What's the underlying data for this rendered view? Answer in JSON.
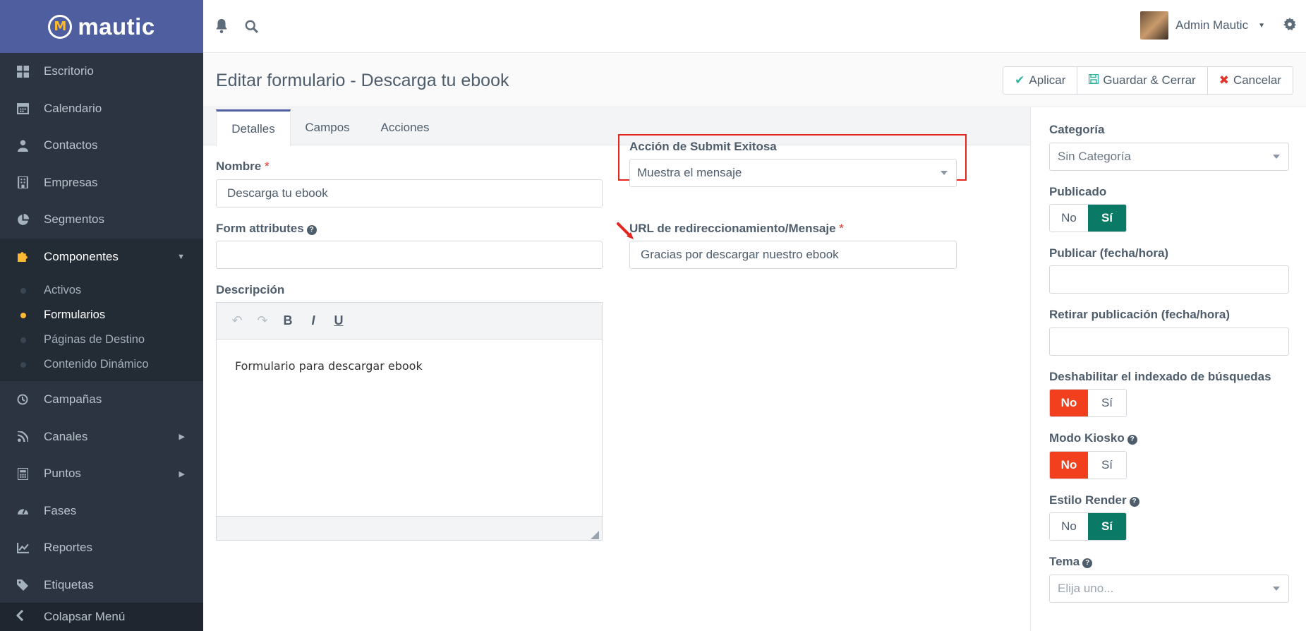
{
  "brand": {
    "name": "mautic",
    "logo_letter": "M"
  },
  "sidebar": {
    "items": [
      {
        "label": "Escritorio",
        "icon": "dashboard-icon"
      },
      {
        "label": "Calendario",
        "icon": "calendar-icon"
      },
      {
        "label": "Contactos",
        "icon": "user-icon"
      },
      {
        "label": "Empresas",
        "icon": "building-icon"
      },
      {
        "label": "Segmentos",
        "icon": "pie-chart-icon"
      },
      {
        "label": "Componentes",
        "icon": "puzzle-icon"
      }
    ],
    "submenu": [
      {
        "label": "Activos"
      },
      {
        "label": "Formularios"
      },
      {
        "label": "Páginas de Destino"
      },
      {
        "label": "Contenido Dinámico"
      }
    ],
    "items_after": [
      {
        "label": "Campañas",
        "icon": "clock-icon"
      },
      {
        "label": "Canales",
        "icon": "rss-icon"
      },
      {
        "label": "Puntos",
        "icon": "calculator-icon"
      },
      {
        "label": "Fases",
        "icon": "gauge-icon"
      },
      {
        "label": "Reportes",
        "icon": "line-chart-icon"
      },
      {
        "label": "Etiquetas",
        "icon": "tag-icon"
      }
    ],
    "collapse_label": "Colapsar Menú"
  },
  "topbar": {
    "user_name": "Admin Mautic"
  },
  "header": {
    "title": "Editar formulario - Descarga tu ebook",
    "apply": "Aplicar",
    "save_close": "Guardar & Cerrar",
    "cancel": "Cancelar"
  },
  "tabs": [
    "Detalles",
    "Campos",
    "Acciones"
  ],
  "form": {
    "name_label": "Nombre",
    "required_mark": "*",
    "name_value": "Descarga tu ebook",
    "attributes_label": "Form attributes",
    "attributes_value": "",
    "description_label": "Descripción",
    "description_value": "Formulario para descargar ebook",
    "submit_action_label": "Acción de Submit Exitosa",
    "submit_action_value": "Muestra el mensaje",
    "redirect_label": "URL de redireccionamiento/Mensaje",
    "redirect_value": "Gracias por descargar nuestro ebook",
    "editor_buttons": {
      "bold": "B",
      "italic": "I",
      "underline": "U"
    }
  },
  "right_panel": {
    "category_label": "Categoría",
    "category_value": "Sin Categoría",
    "published_label": "Publicado",
    "publish_up_label": "Publicar (fecha/hora)",
    "publish_down_label": "Retirar publicación (fecha/hora)",
    "no_index_label": "Deshabilitar el indexado de búsquedas",
    "kiosk_label": "Modo Kiosko",
    "render_style_label": "Estilo Render",
    "theme_label": "Tema",
    "theme_placeholder": "Elija uno...",
    "no": "No",
    "yes": "Sí"
  },
  "colors": {
    "brand_blue": "#4e5e9e",
    "sidebar_bg": "#2b3440",
    "accent_yellow": "#fdb933",
    "toggle_green": "#0a7a67",
    "toggle_red": "#f2401e",
    "annotation_red": "#e4261c"
  }
}
